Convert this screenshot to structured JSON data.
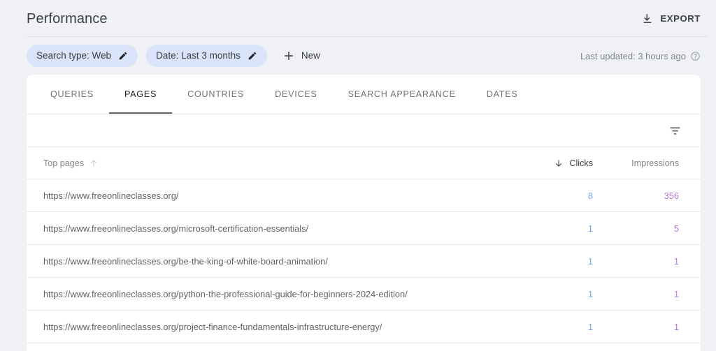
{
  "header": {
    "title": "Performance",
    "export_label": "EXPORT",
    "export_icon": "download-icon"
  },
  "filterbar": {
    "chips": [
      {
        "label": "Search type: Web",
        "edit_icon": "pencil-icon"
      },
      {
        "label": "Date: Last 3 months",
        "edit_icon": "pencil-icon"
      }
    ],
    "new_button": {
      "label": "New",
      "icon": "plus-icon"
    },
    "last_updated": {
      "text": "Last updated: 3 hours ago",
      "icon": "help-circle-icon"
    }
  },
  "tabs": [
    {
      "label": "QUERIES",
      "active": false
    },
    {
      "label": "PAGES",
      "active": true
    },
    {
      "label": "COUNTRIES",
      "active": false
    },
    {
      "label": "DEVICES",
      "active": false
    },
    {
      "label": "SEARCH APPEARANCE",
      "active": false
    },
    {
      "label": "DATES",
      "active": false
    }
  ],
  "toolbar": {
    "filter_icon": "filter-icon"
  },
  "table": {
    "columns": {
      "page": {
        "label": "Top pages",
        "sort_icon": "arrow-up-icon",
        "sorted": false
      },
      "clicks": {
        "label": "Clicks",
        "sort_icon": "arrow-down-icon",
        "sorted": true
      },
      "impressions": {
        "label": "Impressions",
        "sorted": false
      }
    },
    "rows": [
      {
        "url": "https://www.freeonlineclasses.org/",
        "clicks": "8",
        "impressions": "356"
      },
      {
        "url": "https://www.freeonlineclasses.org/microsoft-certification-essentials/",
        "clicks": "1",
        "impressions": "5"
      },
      {
        "url": "https://www.freeonlineclasses.org/be-the-king-of-white-board-animation/",
        "clicks": "1",
        "impressions": "1"
      },
      {
        "url": "https://www.freeonlineclasses.org/python-the-professional-guide-for-beginners-2024-edition/",
        "clicks": "1",
        "impressions": "1"
      },
      {
        "url": "https://www.freeonlineclasses.org/project-finance-fundamentals-infrastructure-energy/",
        "clicks": "1",
        "impressions": "1"
      }
    ]
  },
  "colors": {
    "page_background": "#eff1f5",
    "card_background": "#ffffff",
    "chip_background": "#d9e4fb",
    "clicks_value": "#7aa5e8",
    "impressions_value": "#b17ad4",
    "active_tab_underline": "#5f6368"
  }
}
